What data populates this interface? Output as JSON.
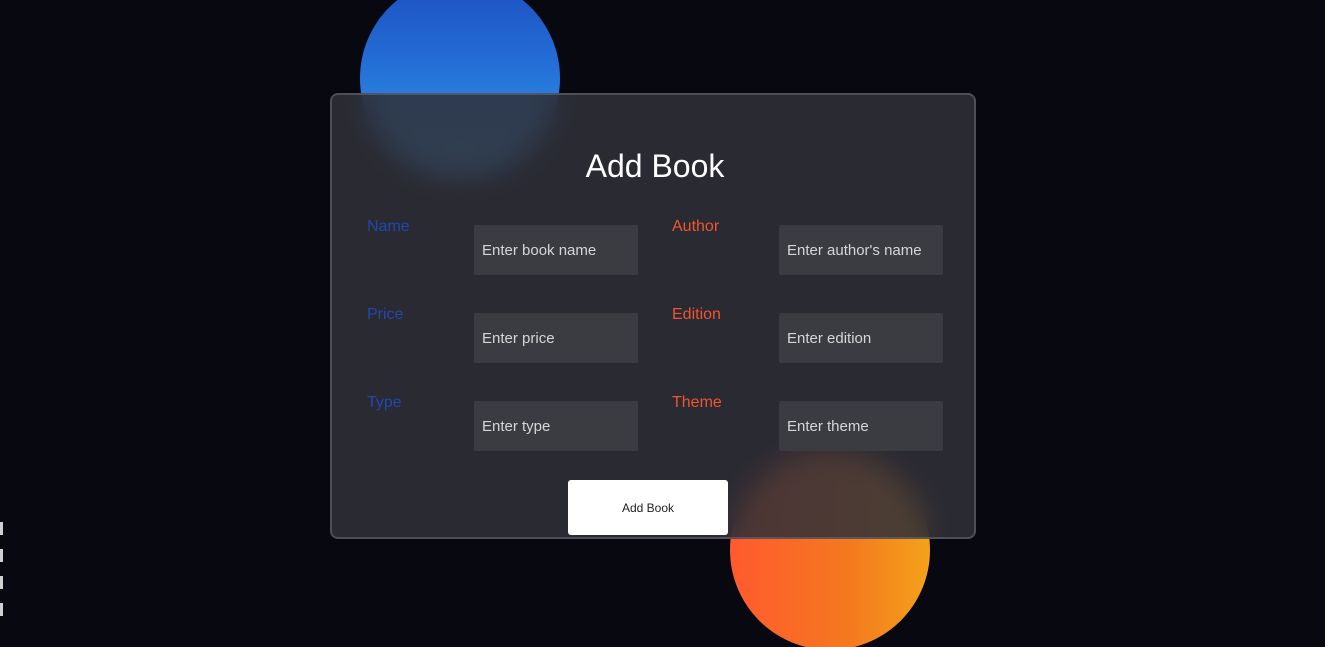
{
  "form": {
    "title": "Add Book",
    "fields": {
      "name": {
        "label": "Name",
        "placeholder": "Enter book name"
      },
      "author": {
        "label": "Author",
        "placeholder": "Enter author's name"
      },
      "price": {
        "label": "Price",
        "placeholder": "Enter price"
      },
      "edition": {
        "label": "Edition",
        "placeholder": "Enter edition"
      },
      "type": {
        "label": "Type",
        "placeholder": "Enter type"
      },
      "theme": {
        "label": "Theme",
        "placeholder": "Enter theme"
      }
    },
    "submit_label": "Add Book"
  },
  "colors": {
    "background": "#080810",
    "card": "#303038",
    "label_left": "#2446b0",
    "label_right": "#ef5530",
    "input_bg": "#3b3b42",
    "button_bg": "#ffffff"
  }
}
